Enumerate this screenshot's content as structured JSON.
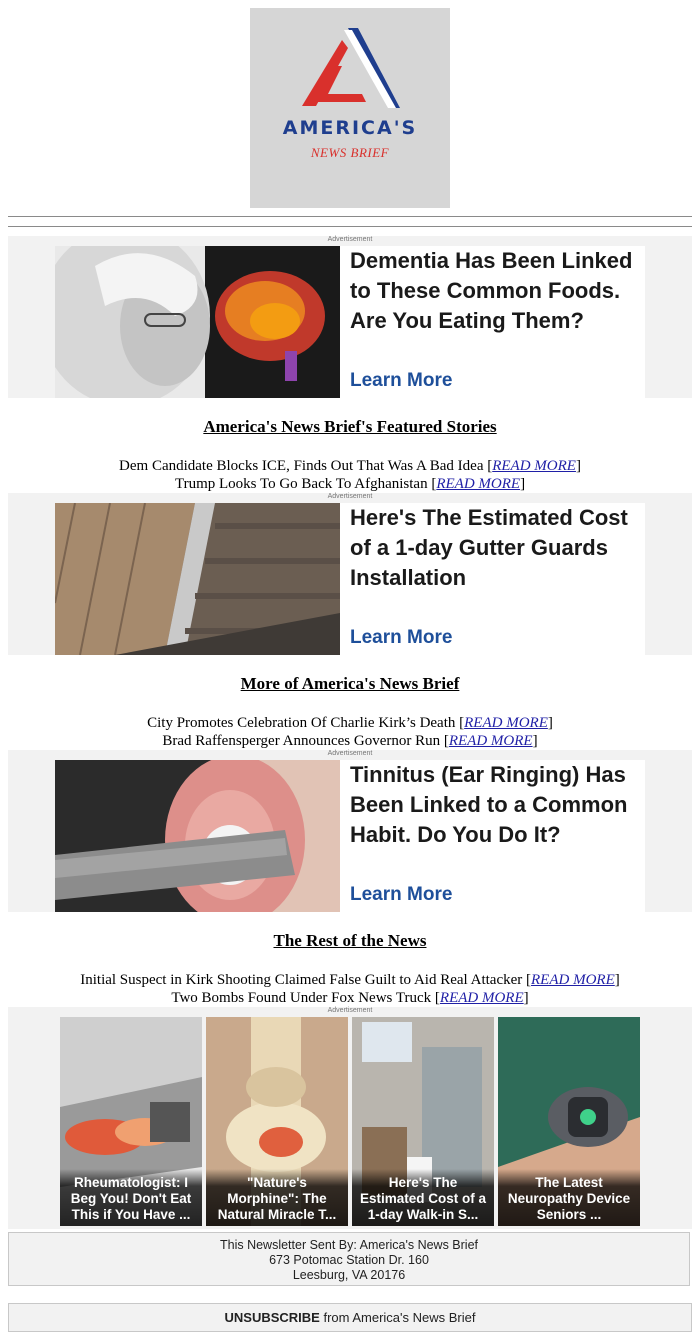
{
  "brand": {
    "logo_main": "AMERICA'S",
    "logo_sub": "NEWS BRIEF"
  },
  "ads": [
    {
      "label": "Advertisement",
      "title": "Dementia Has Been Linked to These Common Foods. Are You Eating Them?",
      "cta": "Learn More",
      "image": "woman-and-brain-photo"
    },
    {
      "label": "Advertisement",
      "title": "Here's The Estimated Cost of a 1-day Gutter Guards Installation",
      "cta": "Learn More",
      "image": "roof-gutter-photo"
    },
    {
      "label": "Advertisement",
      "title": "Tinnitus (Ear Ringing) Has Been Linked to a Common Habit. Do You Do It?",
      "cta": "Learn More",
      "image": "taped-ear-photo"
    }
  ],
  "sections": [
    {
      "heading": "America's News Brief's Featured Stories",
      "stories": [
        {
          "text": "Dem Candidate Blocks ICE, Finds Out That Was A Bad Idea",
          "link": "READ MORE"
        },
        {
          "text": "Trump Looks To Go Back To Afghanistan",
          "link": "READ MORE"
        }
      ]
    },
    {
      "heading": "More of America's News Brief",
      "stories": [
        {
          "text": "City Promotes Celebration Of Charlie Kirk’s Death",
          "link": "READ MORE"
        },
        {
          "text": "Brad Raffensperger Announces Governor Run",
          "link": "READ MORE"
        }
      ]
    },
    {
      "heading": "The Rest of the News",
      "stories": [
        {
          "text": "Initial Suspect in Kirk Shooting Claimed False Guilt to Aid Real Attacker",
          "link": "READ MORE"
        },
        {
          "text": "Two Bombs Found Under Fox News Truck",
          "link": "READ MORE"
        }
      ]
    }
  ],
  "grid_ad": {
    "label": "Advertisement",
    "tiles": [
      {
        "caption": "Rheumatologist: I Beg You! Don't Eat This if You Have ...",
        "image": "knee-pain-photo"
      },
      {
        "caption": "\"Nature's Morphine\": The Natural Miracle T...",
        "image": "knee-joint-illustration"
      },
      {
        "caption": "Here's The Estimated Cost of a 1-day Walk-in S...",
        "image": "walk-in-shower-photo"
      },
      {
        "caption": "The Latest Neuropathy Device Seniors ...",
        "image": "foot-device-photo"
      }
    ]
  },
  "footer": {
    "line1": "This Newsletter Sent By: America's News Brief",
    "line2": "673 Potomac Station Dr. 160",
    "line3": "Leesburg, VA 20176"
  },
  "unsubscribe": {
    "bold": "UNSUBSCRIBE",
    "rest": " from America's News Brief"
  },
  "colors": {
    "logo_blue": "#1f3e8e",
    "logo_red": "#d9302c",
    "cta_blue": "#1e4f9a",
    "link_blue": "#1f1fa6",
    "band_gray": "#f2f2f2"
  }
}
